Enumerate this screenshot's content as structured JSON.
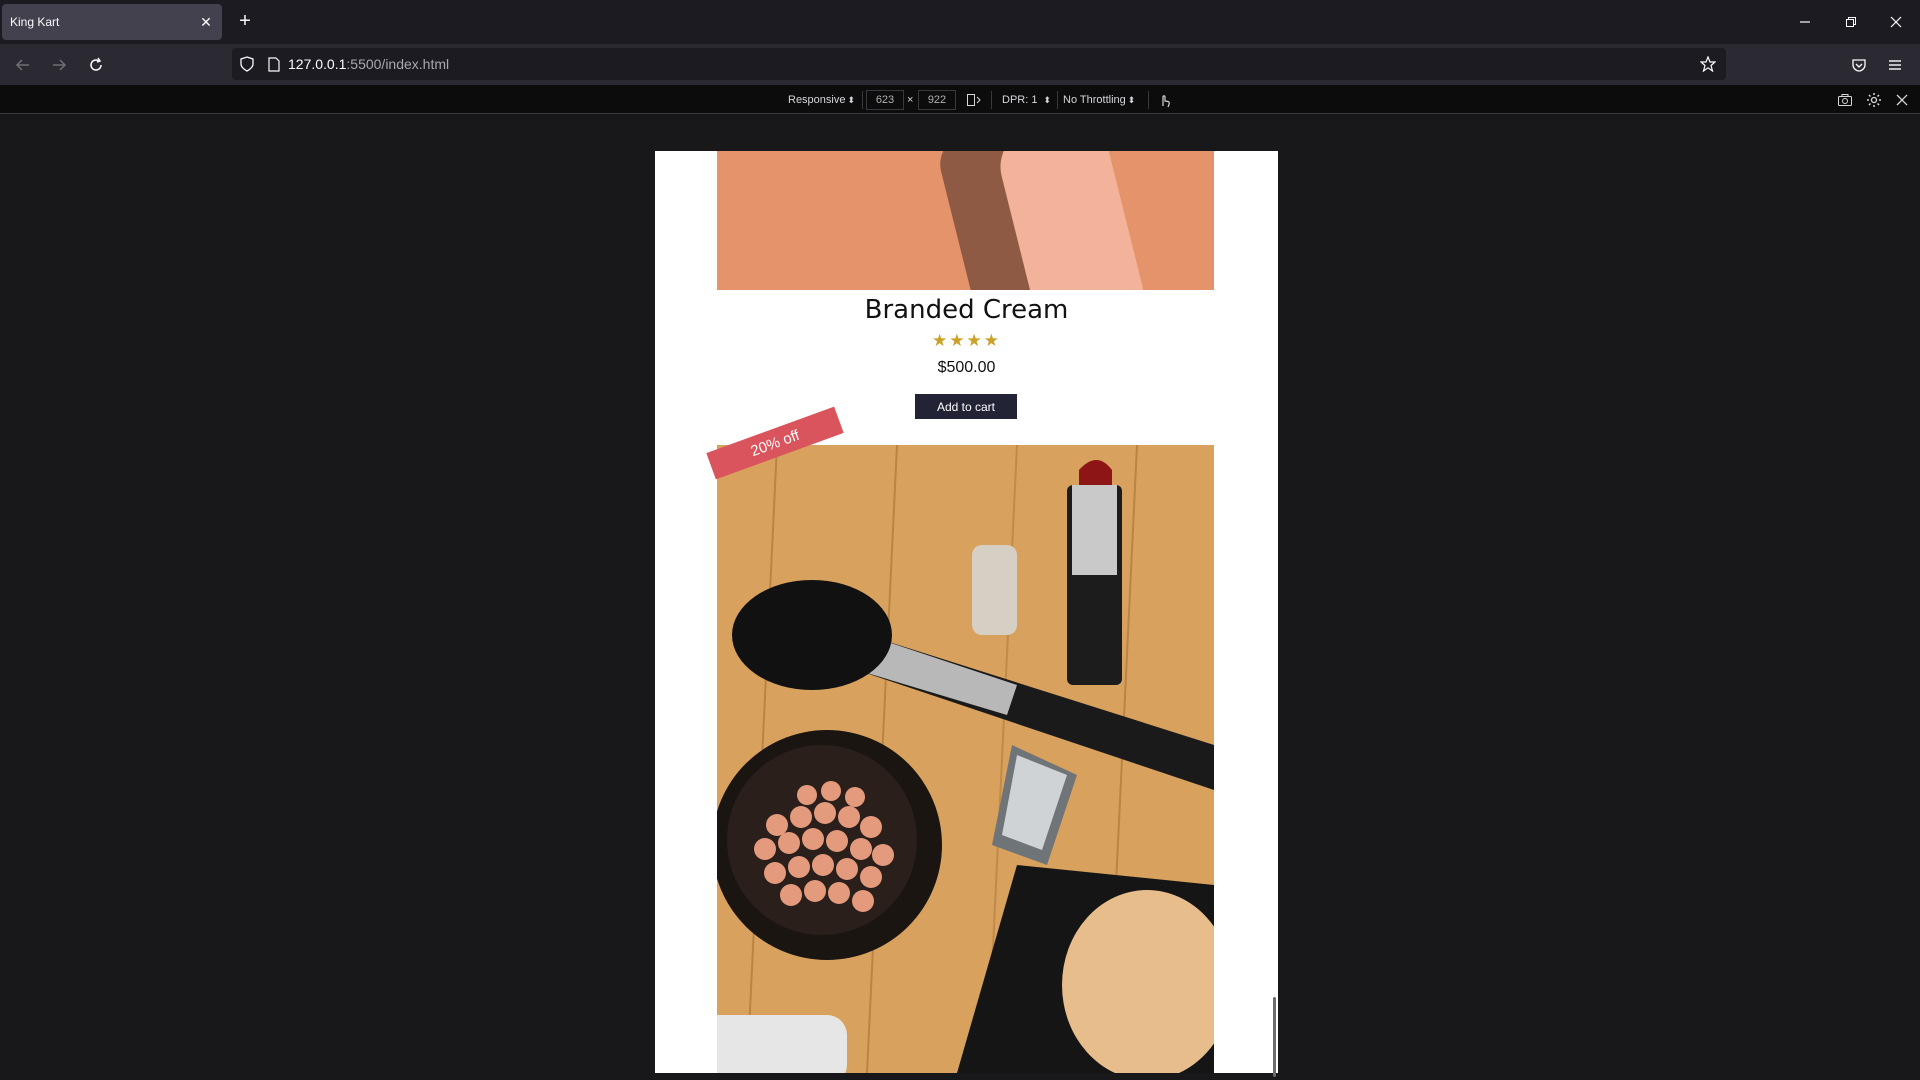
{
  "browser": {
    "tab_title": "King Kart",
    "url_host": "127.0.0.1",
    "url_rest": ":5500/index.html"
  },
  "rdm": {
    "device": "Responsive",
    "width": "623",
    "times": "×",
    "height": "922",
    "dpr": "DPR: 1",
    "throttling": "No Throttling"
  },
  "product": {
    "title": "Branded Cream",
    "rating": 4,
    "stars": "★★★★",
    "price": "$500.00",
    "add_to_cart": "Add to cart"
  },
  "next_product": {
    "badge": "20% off"
  },
  "colors": {
    "button_bg": "#232336",
    "badge_bg": "#d9545c",
    "star": "#c9a227"
  }
}
